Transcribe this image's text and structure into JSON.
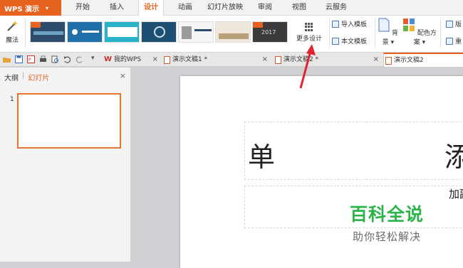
{
  "app": {
    "name": "WPS 演示"
  },
  "menu": {
    "tabs": [
      "开始",
      "插入",
      "设计",
      "动画",
      "幻灯片放映",
      "审阅",
      "视图",
      "云服务"
    ],
    "active": "设计"
  },
  "ribbon": {
    "magic_label": "魔法",
    "thumb_year": "2017",
    "more_design": "更多设计",
    "import_template": "导入模板",
    "this_template": "本文模板",
    "background": "背景",
    "color_scheme": "配色方案",
    "layout_partial": "版",
    "reset_partial": "重"
  },
  "doc_tabs": [
    {
      "label": "我的WPS",
      "type": "wps"
    },
    {
      "label": "演示文稿1 *",
      "type": "doc"
    },
    {
      "label": "演示文稿2 *",
      "type": "doc"
    },
    {
      "label": "演示文稿2",
      "type": "doc",
      "active": true
    }
  ],
  "left_panel": {
    "tab_outline": "大纲",
    "tab_slides": "幻灯片",
    "slide_number": "1"
  },
  "slide": {
    "title_chars": [
      "单",
      "添"
    ],
    "subtitle_partial": "加副"
  },
  "watermark": {
    "main": "百科全说",
    "sub": "助你轻松解决"
  },
  "colors": {
    "accent": "#e8621f",
    "watermark_green": "#2cb34a",
    "annotation_arrow": "#e0232f"
  }
}
